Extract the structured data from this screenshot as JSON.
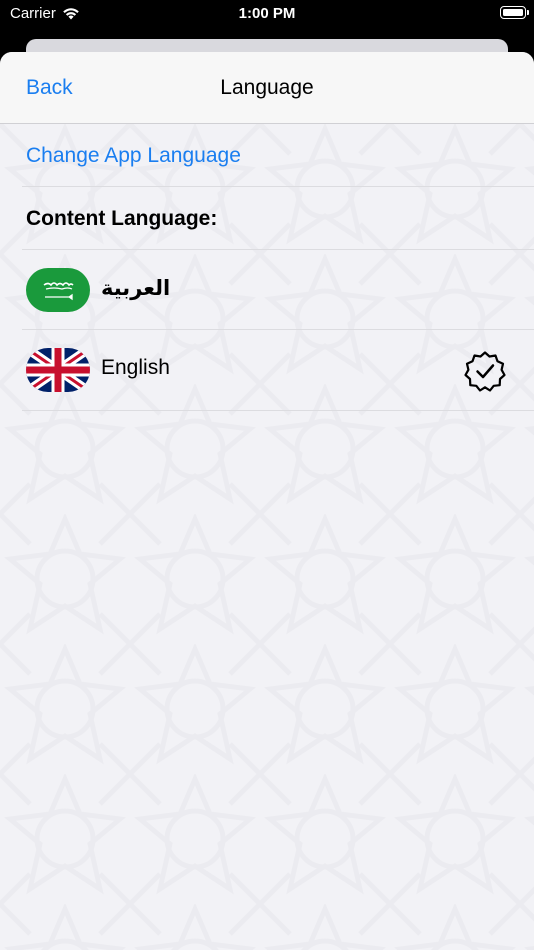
{
  "status_bar": {
    "carrier": "Carrier",
    "time": "1:00 PM"
  },
  "nav": {
    "back_label": "Back",
    "title": "Language"
  },
  "actions": {
    "change_app_language": "Change App Language"
  },
  "content_section": {
    "label": "Content Language:"
  },
  "languages": [
    {
      "label": "العربية",
      "flag_icon": "saudi-arabia-flag-icon",
      "selected": false
    },
    {
      "label": "English",
      "flag_icon": "united-kingdom-flag-icon",
      "selected": true
    }
  ],
  "colors": {
    "accent": "#1a7ef0",
    "background": "#f2f2f6",
    "saudi_green": "#1a9a3c",
    "uk_blue": "#012169",
    "uk_red": "#c8102e"
  }
}
